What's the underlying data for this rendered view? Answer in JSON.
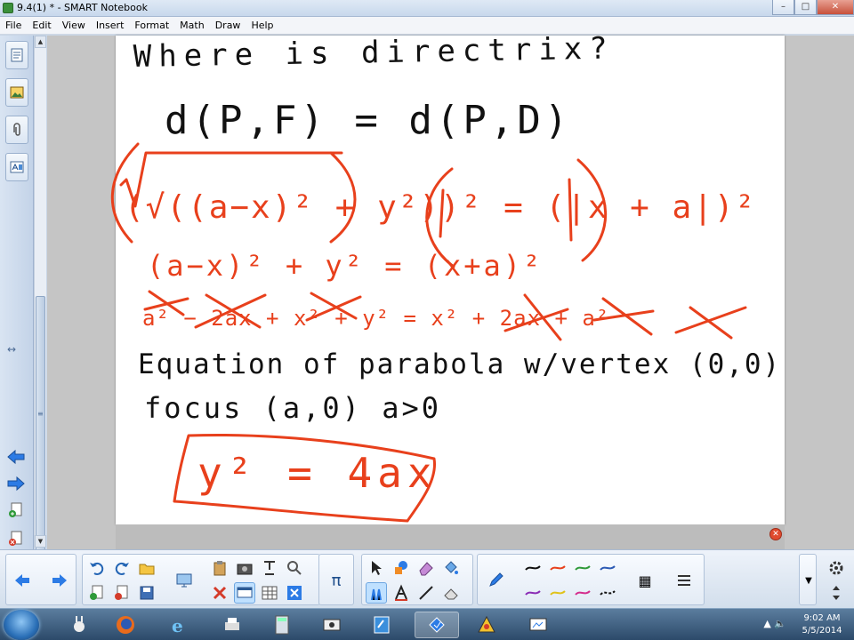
{
  "window": {
    "title": "9.4(1) * - SMART Notebook",
    "minimize": "–",
    "maximize": "□",
    "close": "✕"
  },
  "menu": [
    "File",
    "Edit",
    "View",
    "Insert",
    "Format",
    "Math",
    "Draw",
    "Help"
  ],
  "page_close_glyph": "✕",
  "ink": {
    "line1": "Where is directrix?",
    "line2": "d(P,F) = d(P,D)",
    "line3": "(√((a−x)² + y²))² = (|x + a|)²",
    "line4": "(a−x)² + y² = (x+a)²",
    "line5": "a² − 2ax + x² + y² = x² + 2ax + a²",
    "line6": "Equation of parabola w/vertex (0,0)",
    "line7": "focus (a,0)   a>0",
    "line8": "y² = 4ax"
  },
  "ink_colors": {
    "black": "#111111",
    "red": "#e8401c"
  },
  "toolbar": {
    "math_symbol": "π",
    "gallery_glyph": "▦"
  },
  "clock": {
    "time": "9:02 AM",
    "date": "5/5/2014"
  }
}
